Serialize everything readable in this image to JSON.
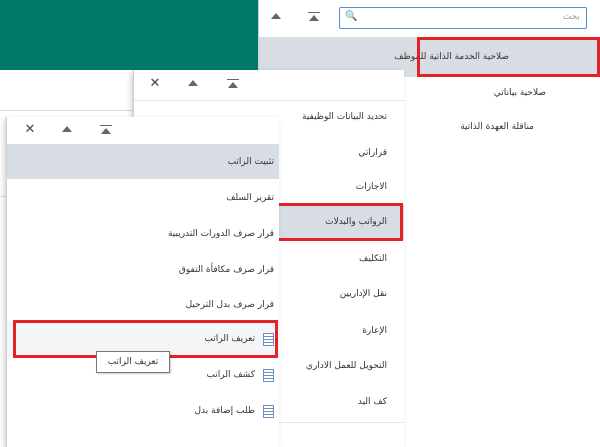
{
  "panel_main": {
    "search_placeholder": "بحث",
    "items": [
      {
        "label": "صلاحية الخدمة الذاتية للموظف"
      },
      {
        "label": "صلاحية بياناتي"
      },
      {
        "label": "مناقلة العهدة الذاتية"
      }
    ]
  },
  "panel_second": {
    "items": [
      {
        "label": "تحديد البيانات الوظيفية"
      },
      {
        "label": "قراراتي"
      },
      {
        "label": "الاجازات"
      },
      {
        "label": "الرواتب والبدلات"
      },
      {
        "label": "التكليف"
      },
      {
        "label": "نقل الإداريين"
      },
      {
        "label": "الإعارة"
      },
      {
        "label": "التحويل للعمل الاداري"
      },
      {
        "label": "كف اليد"
      }
    ]
  },
  "panel_third": {
    "items": [
      {
        "label": "تثبيت الراتب"
      },
      {
        "label": "تقرير السلف"
      },
      {
        "label": "قرار صرف الدورات التدريبية"
      },
      {
        "label": "قرار صرف مكافأة التفوق"
      },
      {
        "label": "قرار صرف بدل الترحيل"
      },
      {
        "label": "تعريف الراتب",
        "icon": "document-icon"
      },
      {
        "label": "كشف الراتب",
        "icon": "document-icon"
      },
      {
        "label": "طلب إضافة بدل",
        "icon": "document-icon"
      }
    ]
  },
  "tooltip": "تعريف الراتب",
  "colors": {
    "header_band": "#00796B",
    "highlight": "#e32228",
    "selected_row": "#d8dde3",
    "search_border": "#4a90d9"
  }
}
